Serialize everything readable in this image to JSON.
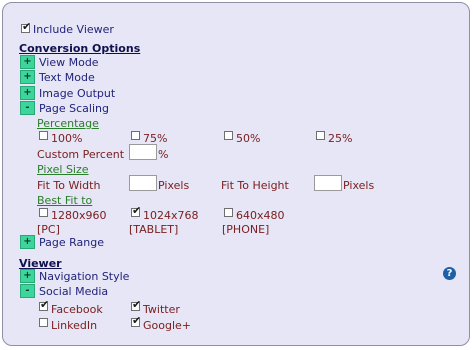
{
  "include_viewer": {
    "label": "Include Viewer",
    "checked": true
  },
  "conversion": {
    "title": "Conversion Options",
    "items": [
      {
        "toggle": "+",
        "label": "View Mode"
      },
      {
        "toggle": "+",
        "label": "Text Mode"
      },
      {
        "toggle": "+",
        "label": "Image Output"
      },
      {
        "toggle": "-",
        "label": "Page Scaling"
      }
    ]
  },
  "percentage": {
    "link": "Percentage",
    "options": [
      "100%",
      "75%",
      "50%",
      "25%"
    ],
    "custom_label": "Custom Percent",
    "custom_value": "",
    "custom_unit": "%"
  },
  "pixel_size": {
    "link": "Pixel Size",
    "fit_width_label": "Fit To Width",
    "fit_width_value": "",
    "fit_height_label": "Fit To Height",
    "fit_height_value": "",
    "unit": "Pixels"
  },
  "best_fit": {
    "link": "Best Fit to",
    "options": [
      {
        "size": "1280x960",
        "device": "[PC]",
        "checked": false
      },
      {
        "size": "1024x768",
        "device": "[TABLET]",
        "checked": true
      },
      {
        "size": "640x480",
        "device": "[PHONE]",
        "checked": false
      }
    ]
  },
  "page_range": {
    "toggle": "+",
    "label": "Page Range"
  },
  "viewer": {
    "title": "Viewer",
    "items": [
      {
        "toggle": "+",
        "label": "Navigation Style"
      },
      {
        "toggle": "-",
        "label": "Social Media"
      }
    ]
  },
  "social": [
    {
      "label": "Facebook",
      "checked": true
    },
    {
      "label": "Twitter",
      "checked": true
    },
    {
      "label": "LinkedIn",
      "checked": false
    },
    {
      "label": "Google+",
      "checked": true
    }
  ],
  "help_icon_glyph": "?",
  "check_glyph": "✔",
  "colors": {
    "panel_bg": "#e6e6f6",
    "toggle_green": "#3cd69c",
    "navy_text": "#22237a",
    "maroon_text": "#7a2020",
    "link_green": "#2a7d2a"
  }
}
